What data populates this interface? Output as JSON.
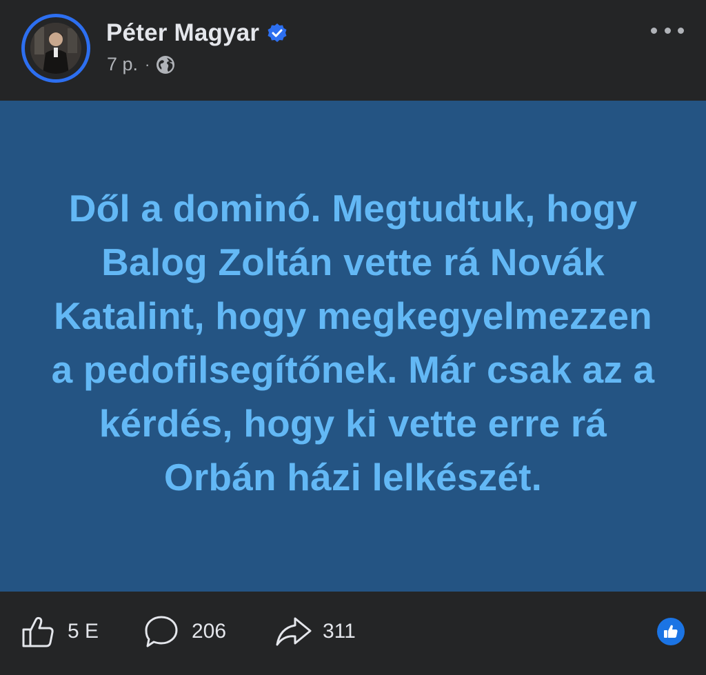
{
  "post": {
    "author_name": "Péter Magyar",
    "time_ago": "7 p.",
    "separator": "·",
    "audience_icon": "globe-icon",
    "verified_icon": "verified-badge-icon",
    "menu_icon": "more-options-icon",
    "text": "Dől a dominó. Megtudtuk, hogy Balog Zoltán vette rá Novák Katalint, hogy megkegyelmezzen a pedofilsegítőnek. Már csak az a kérdés, hogy ki vette erre rá Orbán házi lelkészét.",
    "background_color": "#245483",
    "text_color": "#63b8f5"
  },
  "actions": {
    "likes": {
      "icon": "thumbs-up-icon",
      "count": "5 E"
    },
    "comments": {
      "icon": "comment-icon",
      "count": "206"
    },
    "shares": {
      "icon": "share-icon",
      "count": "311"
    },
    "reaction_icon": "like-reaction-icon"
  },
  "colors": {
    "accent": "#2d6ff0",
    "like_blue": "#1b74e4",
    "surface": "#242526"
  }
}
